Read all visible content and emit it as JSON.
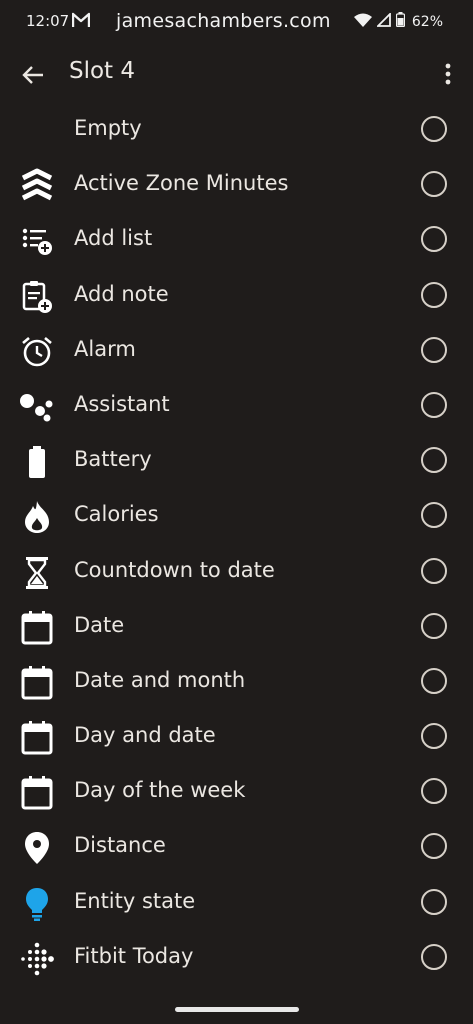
{
  "status": {
    "time": "12:07",
    "watermark": "jamesachambers.com",
    "battery": "62%"
  },
  "header": {
    "title": "Slot 4"
  },
  "items": [
    {
      "label": "Empty",
      "icon": "none"
    },
    {
      "label": "Active Zone Minutes",
      "icon": "chevrons-up-icon"
    },
    {
      "label": "Add list",
      "icon": "list-add-icon"
    },
    {
      "label": "Add note",
      "icon": "note-add-icon"
    },
    {
      "label": "Alarm",
      "icon": "alarm-icon"
    },
    {
      "label": "Assistant",
      "icon": "assistant-icon"
    },
    {
      "label": "Battery",
      "icon": "battery-icon"
    },
    {
      "label": "Calories",
      "icon": "flame-icon"
    },
    {
      "label": "Countdown to date",
      "icon": "hourglass-icon"
    },
    {
      "label": "Date",
      "icon": "calendar-icon"
    },
    {
      "label": "Date and month",
      "icon": "calendar-icon"
    },
    {
      "label": "Day and date",
      "icon": "calendar-icon"
    },
    {
      "label": "Day of the week",
      "icon": "calendar-icon"
    },
    {
      "label": "Distance",
      "icon": "location-pin-icon"
    },
    {
      "label": "Entity state",
      "icon": "lightbulb-icon"
    },
    {
      "label": "Fitbit Today",
      "icon": "fitbit-dots-icon"
    }
  ],
  "colors": {
    "background": "#1f1c1b",
    "text": "#ebe7e2",
    "radio": "#d6d0c8",
    "accent_blue": "#1ea4e9"
  }
}
